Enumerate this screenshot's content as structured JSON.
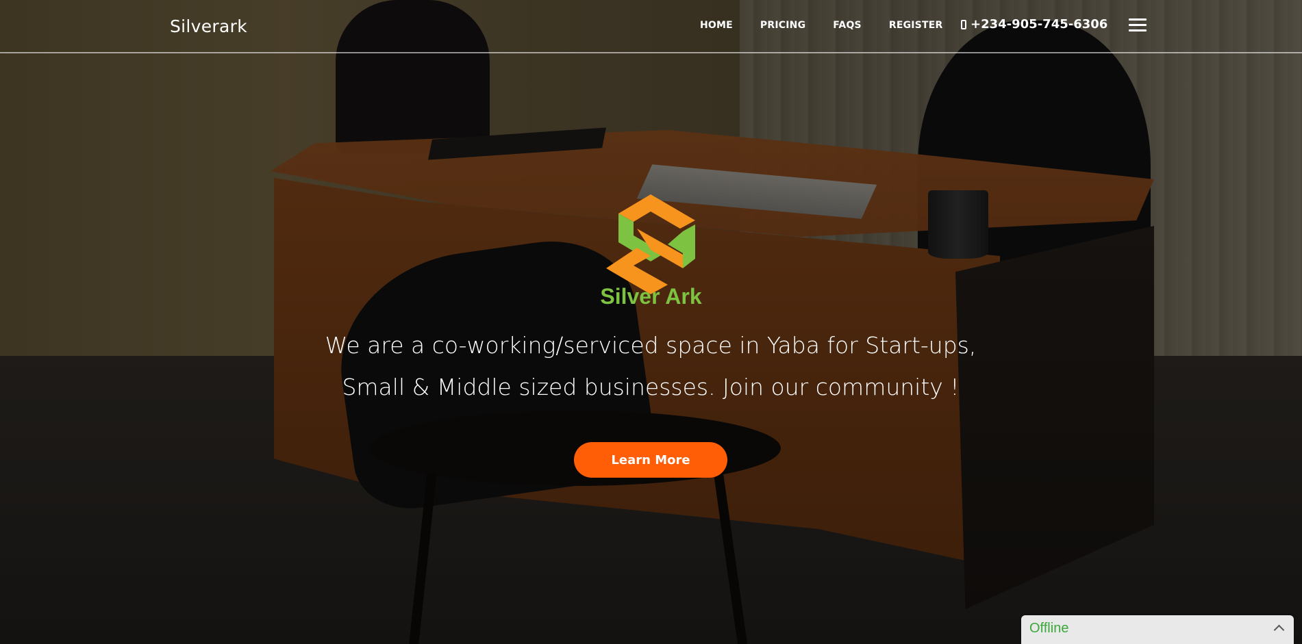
{
  "navbar": {
    "brand": "Silverark",
    "links": [
      "HOME",
      "PRICING",
      "FAQS",
      "REGISTER"
    ],
    "phone": "+234-905-745-6306",
    "phone_icon": "mobile-phone-icon",
    "menu_icon": "hamburger-menu-icon"
  },
  "hero": {
    "logo_text": "Silver Ark",
    "tagline": "We are a co-working/serviced space in Yaba for Start-ups, Small & Middle sized businesses. Join our community !",
    "cta_label": "Learn More"
  },
  "chat_widget": {
    "status": "Offline",
    "toggle_icon": "chevron-up-icon"
  },
  "colors": {
    "cta": "#ff5d06",
    "logo_green": "#7ec242",
    "logo_orange": "#f7941d",
    "chat_status": "#3aa83a"
  }
}
